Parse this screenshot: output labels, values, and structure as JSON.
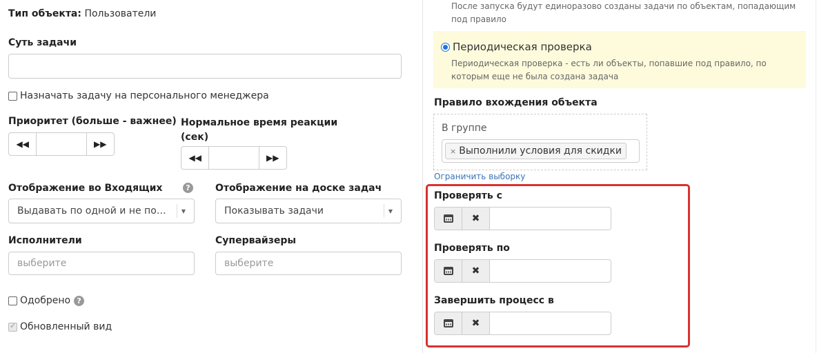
{
  "left": {
    "object_type_label": "Тип объекта",
    "object_type_colon": ":",
    "object_type_value": "Пользователи",
    "task_essence_label": "Суть задачи",
    "task_essence_value": "",
    "assign_manager_label": "Назначать задачу на персонального менеджера",
    "priority_label": "Приоритет (больше - важнее)",
    "reaction_time_label_1": "Нормальное время реакции",
    "reaction_time_label_2": "(сек)",
    "stepper_prev": "◀◀",
    "stepper_next": "▶▶",
    "inbox_display_label": "Отображение во Входящих",
    "inbox_display_value": "Выдавать по одной и не показ…",
    "board_display_label": "Отображение на доске задач",
    "board_display_value": "Показывать задачи",
    "assignees_label": "Исполнители",
    "assignees_placeholder": "выберите",
    "supervisors_label": "Супервайзеры",
    "supervisors_placeholder": "выберите",
    "approved_label": "Одобрено",
    "updated_view_label": "Обновленный вид",
    "help_glyph": "?"
  },
  "right": {
    "run_once_help": "После запуска будут единоразово созданы задачи по объектам, попадающим под правило",
    "periodic_label": "Периодическая проверка",
    "periodic_help": "Периодическая проверка - есть ли объекты, попавшие под правило, по которым еще не была создана задача",
    "entry_rule_label": "Правило вхождения объекта",
    "in_group_label": "В группе",
    "group_tag_remove": "×",
    "group_tag": "Выполнили условия для скидки",
    "limit_link": "Ограничить выборку",
    "check_from_label": "Проверять с",
    "check_to_label": "Проверять по",
    "finish_process_label": "Завершить процесс в",
    "clear_glyph": "✖"
  },
  "colors": {
    "highlight_bg": "#fdfbdc",
    "red_frame": "#d93030",
    "link": "#3a73b8",
    "radio": "#1a73e8"
  }
}
